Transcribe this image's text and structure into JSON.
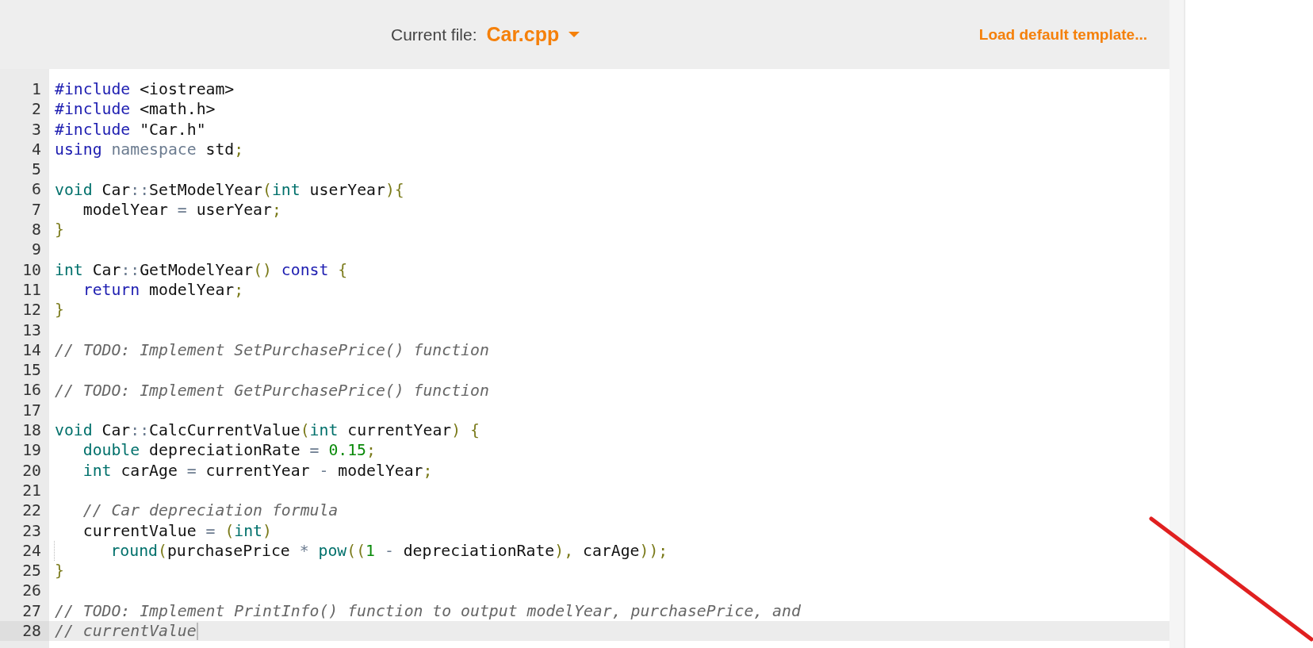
{
  "header": {
    "label": "Current file:",
    "file": "Car.cpp",
    "action": "Load default template..."
  },
  "lines": [
    {
      "number": "1",
      "active": false,
      "tokens": [
        {
          "kind": "meta",
          "text": "#include"
        },
        {
          "kind": "plain",
          "text": " <iostream>"
        }
      ]
    },
    {
      "number": "2",
      "active": false,
      "tokens": [
        {
          "kind": "meta",
          "text": "#include"
        },
        {
          "kind": "plain",
          "text": " <math.h>"
        }
      ]
    },
    {
      "number": "3",
      "active": false,
      "tokens": [
        {
          "kind": "meta",
          "text": "#include"
        },
        {
          "kind": "plain",
          "text": " \"Car.h\""
        }
      ]
    },
    {
      "number": "4",
      "active": false,
      "tokens": [
        {
          "kind": "keyword",
          "text": "using"
        },
        {
          "kind": "namespace",
          "text": " namespace"
        },
        {
          "kind": "plain",
          "text": " std"
        },
        {
          "kind": "punct",
          "text": ";"
        }
      ]
    },
    {
      "number": "5",
      "active": false
    },
    {
      "number": "6",
      "active": false,
      "tokens": [
        {
          "kind": "type",
          "text": "void"
        },
        {
          "kind": "plain",
          "text": " Car"
        },
        {
          "kind": "op",
          "text": "::"
        },
        {
          "kind": "plain",
          "text": "SetModelYear"
        },
        {
          "kind": "punct",
          "text": "("
        },
        {
          "kind": "type",
          "text": "int"
        },
        {
          "kind": "plain",
          "text": " userYear"
        },
        {
          "kind": "punct",
          "text": "){"
        }
      ]
    },
    {
      "number": "7",
      "active": false,
      "tokens": [
        {
          "kind": "plain",
          "text": "   modelYear"
        },
        {
          "kind": "op",
          "text": " ="
        },
        {
          "kind": "plain",
          "text": " userYear"
        },
        {
          "kind": "punct",
          "text": ";"
        }
      ]
    },
    {
      "number": "8",
      "active": false,
      "tokens": [
        {
          "kind": "punct",
          "text": "}"
        }
      ]
    },
    {
      "number": "9",
      "active": false
    },
    {
      "number": "10",
      "active": false,
      "tokens": [
        {
          "kind": "type",
          "text": "int"
        },
        {
          "kind": "plain",
          "text": " Car"
        },
        {
          "kind": "op",
          "text": "::"
        },
        {
          "kind": "plain",
          "text": "GetModelYear"
        },
        {
          "kind": "punct",
          "text": "()"
        },
        {
          "kind": "keyword",
          "text": " const"
        },
        {
          "kind": "punct",
          "text": " {"
        }
      ]
    },
    {
      "number": "11",
      "active": false,
      "tokens": [
        {
          "kind": "keyword",
          "text": "   return"
        },
        {
          "kind": "plain",
          "text": " modelYear"
        },
        {
          "kind": "punct",
          "text": ";"
        }
      ]
    },
    {
      "number": "12",
      "active": false,
      "tokens": [
        {
          "kind": "punct",
          "text": "}"
        }
      ]
    },
    {
      "number": "13",
      "active": false
    },
    {
      "number": "14",
      "active": false,
      "tokens": [
        {
          "kind": "comment",
          "text": "// TODO: Implement SetPurchasePrice() function"
        }
      ]
    },
    {
      "number": "15",
      "active": false
    },
    {
      "number": "16",
      "active": false,
      "tokens": [
        {
          "kind": "comment",
          "text": "// TODO: Implement GetPurchasePrice() function"
        }
      ]
    },
    {
      "number": "17",
      "active": false
    },
    {
      "number": "18",
      "active": false,
      "tokens": [
        {
          "kind": "type",
          "text": "void"
        },
        {
          "kind": "plain",
          "text": " Car"
        },
        {
          "kind": "op",
          "text": "::"
        },
        {
          "kind": "plain",
          "text": "CalcCurrentValue"
        },
        {
          "kind": "punct",
          "text": "("
        },
        {
          "kind": "type",
          "text": "int"
        },
        {
          "kind": "plain",
          "text": " currentYear"
        },
        {
          "kind": "punct",
          "text": ") {"
        }
      ]
    },
    {
      "number": "19",
      "active": false,
      "tokens": [
        {
          "kind": "type",
          "text": "   double"
        },
        {
          "kind": "plain",
          "text": " depreciationRate"
        },
        {
          "kind": "op",
          "text": " ="
        },
        {
          "kind": "number",
          "text": " 0.15"
        },
        {
          "kind": "punct",
          "text": ";"
        }
      ]
    },
    {
      "number": "20",
      "active": false,
      "tokens": [
        {
          "kind": "type",
          "text": "   int"
        },
        {
          "kind": "plain",
          "text": " carAge"
        },
        {
          "kind": "op",
          "text": " ="
        },
        {
          "kind": "plain",
          "text": " currentYear"
        },
        {
          "kind": "op",
          "text": " -"
        },
        {
          "kind": "plain",
          "text": " modelYear"
        },
        {
          "kind": "punct",
          "text": ";"
        }
      ]
    },
    {
      "number": "21",
      "active": false
    },
    {
      "number": "22",
      "active": false,
      "tokens": [
        {
          "kind": "comment",
          "text": "   // Car depreciation formula"
        }
      ]
    },
    {
      "number": "23",
      "active": false,
      "tokens": [
        {
          "kind": "plain",
          "text": "   currentValue"
        },
        {
          "kind": "op",
          "text": " ="
        },
        {
          "kind": "punct",
          "text": " ("
        },
        {
          "kind": "type",
          "text": "int"
        },
        {
          "kind": "punct",
          "text": ")"
        }
      ]
    },
    {
      "number": "24",
      "active": false,
      "tokens": [
        {
          "kind": "guide"
        },
        {
          "kind": "type",
          "text": "   round"
        },
        {
          "kind": "punct",
          "text": "("
        },
        {
          "kind": "plain",
          "text": "purchasePrice"
        },
        {
          "kind": "op",
          "text": " *"
        },
        {
          "kind": "type",
          "text": " pow"
        },
        {
          "kind": "punct",
          "text": "(("
        },
        {
          "kind": "number",
          "text": "1"
        },
        {
          "kind": "op",
          "text": " -"
        },
        {
          "kind": "plain",
          "text": " depreciationRate"
        },
        {
          "kind": "punct",
          "text": "),"
        },
        {
          "kind": "plain",
          "text": " carAge"
        },
        {
          "kind": "punct",
          "text": "));"
        }
      ]
    },
    {
      "number": "25",
      "active": false,
      "tokens": [
        {
          "kind": "punct",
          "text": "}"
        }
      ]
    },
    {
      "number": "26",
      "active": false
    },
    {
      "number": "27",
      "active": false,
      "tokens": [
        {
          "kind": "comment",
          "text": "// TODO: Implement PrintInfo() function to output modelYear, purchasePrice, and"
        }
      ]
    },
    {
      "number": "28",
      "active": true,
      "tokens": [
        {
          "kind": "comment",
          "text": "// currentValue"
        }
      ]
    }
  ]
}
